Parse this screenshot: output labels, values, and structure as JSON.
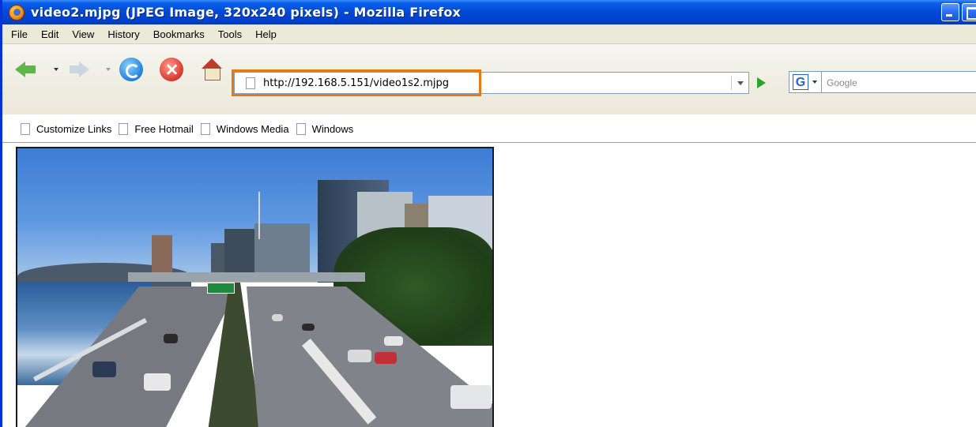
{
  "window": {
    "title": "video2.mjpg (JPEG Image, 320x240 pixels) - Mozilla Firefox",
    "icon": "firefox-icon"
  },
  "menubar": {
    "items": [
      "File",
      "Edit",
      "View",
      "History",
      "Bookmarks",
      "Tools",
      "Help"
    ]
  },
  "toolbar": {
    "buttons": [
      "back-icon",
      "forward-icon",
      "reload-icon",
      "stop-icon",
      "home-icon"
    ],
    "address_url": "http://192.168.5.151/video1s2.mjpg",
    "search_engine": "G",
    "search_placeholder": "Google",
    "highlight_color": "#e07b16"
  },
  "bookmarks": {
    "items": [
      "Customize Links",
      "Free Hotmail",
      "Windows Media",
      "Windows"
    ]
  },
  "content": {
    "image_desc_icon": "video-frame"
  },
  "colors": {
    "titlebar": "#0049d6",
    "chrome": "#ece9d8"
  }
}
